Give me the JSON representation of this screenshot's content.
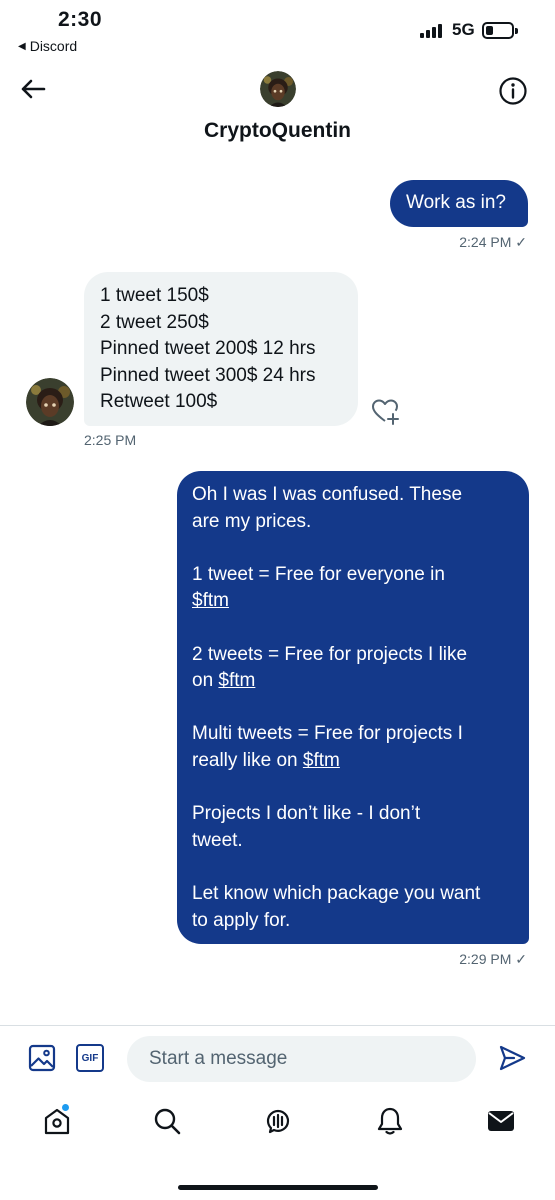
{
  "status_bar": {
    "time": "2:30",
    "back_app": "Discord",
    "network": "5G"
  },
  "header": {
    "title": "CryptoQuentin"
  },
  "messages": [
    {
      "direction": "sent",
      "lines": [
        [
          "Work as in?"
        ]
      ],
      "meta": "2:24 PM ✓"
    },
    {
      "direction": "received",
      "lines": [
        [
          "1 tweet 150$"
        ],
        [
          "2 tweet 250$"
        ],
        [
          "Pinned tweet 200$ 12 hrs"
        ],
        [
          "Pinned tweet 300$ 24 hrs"
        ],
        [
          "Retweet 100$"
        ]
      ],
      "meta": "2:25 PM"
    },
    {
      "direction": "sent",
      "lines": [
        [
          "Oh I was I was confused. These"
        ],
        [
          "are my prices."
        ],
        [
          ""
        ],
        [
          "1 tweet = Free for everyone in"
        ],
        [
          "",
          "$ftm"
        ],
        [
          ""
        ],
        [
          "2 tweets = Free for projects I like"
        ],
        [
          "on ",
          "$ftm"
        ],
        [
          ""
        ],
        [
          "Multi tweets = Free for projects I"
        ],
        [
          "really like on ",
          "$ftm"
        ],
        [
          ""
        ],
        [
          "Projects I don’t like - I don’t"
        ],
        [
          "tweet."
        ],
        [
          ""
        ],
        [
          "Let know which package you want"
        ],
        [
          "to apply for."
        ]
      ],
      "meta": "2:29 PM ✓"
    }
  ],
  "composer": {
    "placeholder": "Start a message",
    "gif_label": "GIF"
  },
  "tab_bar": {
    "items": [
      "home-icon",
      "search-icon",
      "spaces-icon",
      "notifications-icon",
      "messages-icon"
    ],
    "home_has_notification": true
  },
  "colors": {
    "sent_bubble": "#14398a",
    "received_bubble": "#eff3f4",
    "accent": "#1d9bf0",
    "meta_text": "#536471"
  }
}
